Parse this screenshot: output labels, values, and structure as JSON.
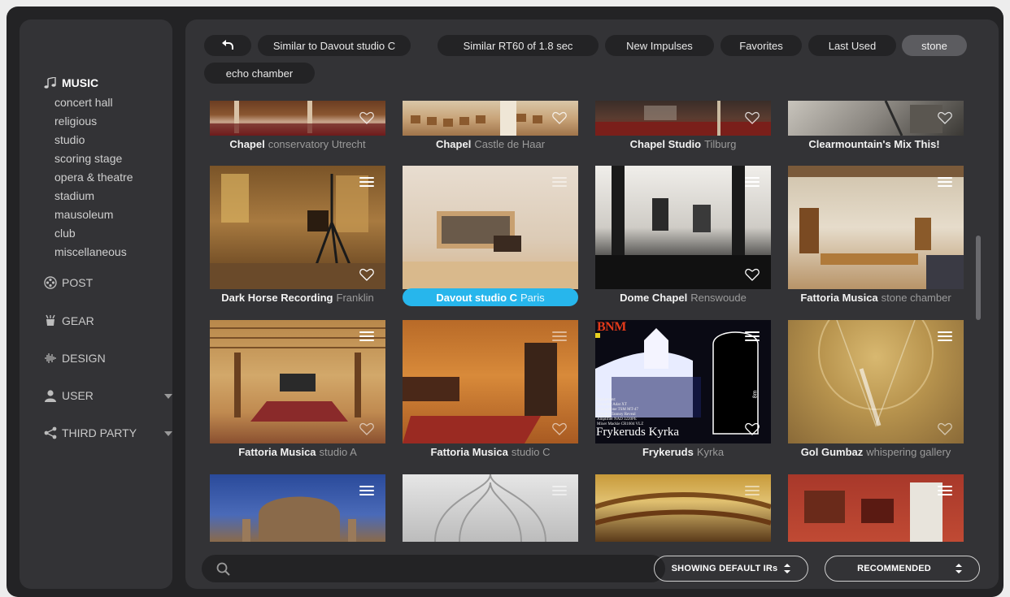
{
  "sidebar": {
    "categories": [
      {
        "icon": "music-note-icon",
        "label": "MUSIC",
        "active": true
      },
      {
        "icon": "film-reel-icon",
        "label": "POST"
      },
      {
        "icon": "gear-tool-icon",
        "label": "GEAR"
      },
      {
        "icon": "waveform-icon",
        "label": "DESIGN"
      },
      {
        "icon": "user-icon",
        "label": "USER"
      },
      {
        "icon": "share-icon",
        "label": "THIRD PARTY"
      }
    ],
    "music_items": [
      "concert hall",
      "religious",
      "studio",
      "scoring stage",
      "opera & theatre",
      "stadium",
      "mausoleum",
      "club",
      "miscellaneous"
    ]
  },
  "filters": {
    "back_icon": "undo-arrow-icon",
    "chips": [
      "Similar to Davout studio C",
      "Similar RT60 of 1.8 sec",
      "New Impulses",
      "Favorites",
      "Last Used",
      "stone",
      "echo chamber"
    ],
    "selected_chip": "stone"
  },
  "tiles": [
    {
      "name": "Chapel",
      "location": "conservatory Utrecht"
    },
    {
      "name": "Chapel",
      "location": "Castle de Haar"
    },
    {
      "name": "Chapel Studio",
      "location": "Tilburg"
    },
    {
      "name": "Clearmountain's Mix This!",
      "location": ""
    },
    {
      "name": "Dark Horse Recording",
      "location": "Franklin"
    },
    {
      "name": "Davout studio C",
      "location": "Paris",
      "selected": true
    },
    {
      "name": "Dome Chapel",
      "location": "Renswoude"
    },
    {
      "name": "Fattoria Musica",
      "location": "stone chamber"
    },
    {
      "name": "Fattoria Musica",
      "location": "studio A"
    },
    {
      "name": "Fattoria Musica",
      "location": "studio C"
    },
    {
      "name": "Frykeruds",
      "location": "Kyrka"
    },
    {
      "name": "Gol Gumbaz",
      "location": "whispering gallery"
    }
  ],
  "frykeruds_art": {
    "logo": "BNM",
    "title": "Frykeruds Kyrka",
    "scale": "8m",
    "specs": [
      "Equipment:",
      "Recorder  Adat XT",
      "Microphone  TSM MT-47",
      "Monitor  Tannoy Reveal",
      "Amplifier  NAD 3220PE",
      "Mixer  Mackie CR1604 VLZ"
    ]
  },
  "search": {
    "placeholder": "",
    "icon": "search-icon"
  },
  "bottom": {
    "ir_filter": "SHOWING DEFAULT IRs",
    "sort": "RECOMMENDED"
  },
  "colors": {
    "accent": "#27b6ec",
    "panel": "#333336",
    "background": "#232325"
  }
}
